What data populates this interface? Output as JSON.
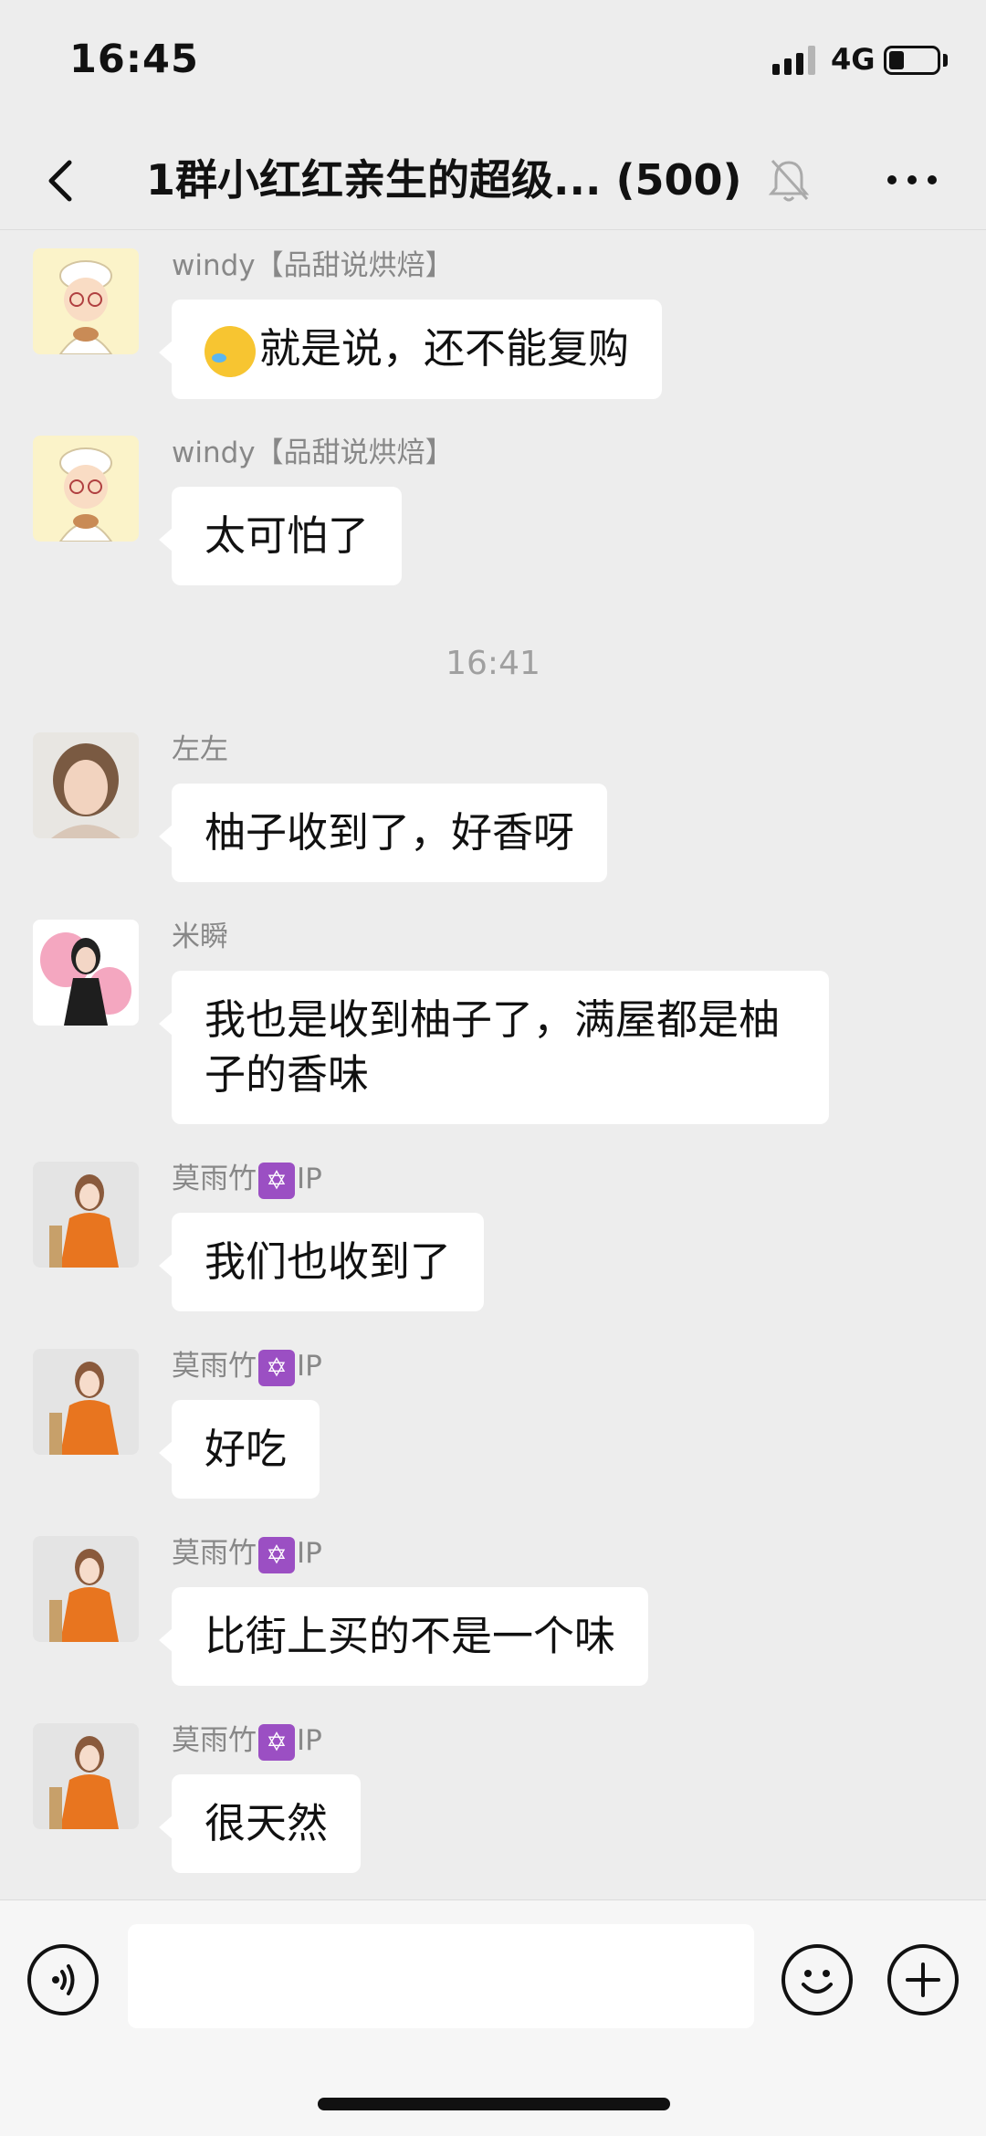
{
  "status_bar": {
    "time": "16:45",
    "network": "4G",
    "signal_bars": 3,
    "signal_bars_total": 4,
    "battery_level": 0.3
  },
  "nav": {
    "title": "1群小红红亲生的超级... (500)"
  },
  "icons": {
    "back": "chevron-left-icon",
    "mute": "bell-off-icon",
    "more": "more-dots-icon",
    "voice": "voice-icon",
    "emoji": "smiley-icon",
    "plus": "plus-icon"
  },
  "colors": {
    "background": "#ededed",
    "bubble": "#ffffff",
    "sender": "#888888",
    "timestamp": "#a0a0a0",
    "badge": "#9b4fc3"
  },
  "messages": [
    {
      "sender": "windy【品甜说烘焙】",
      "emoji": "crying-laughing-emoji",
      "text": "就是说，还不能复购"
    },
    {
      "sender": "windy【品甜说烘焙】",
      "text": "太可怕了"
    },
    {
      "timestamp": "16:41"
    },
    {
      "sender": "左左",
      "text": "柚子收到了，好香呀"
    },
    {
      "sender": "米瞬",
      "text": "我也是收到柚子了，满屋都是柚子的香味"
    },
    {
      "sender": "莫雨竹",
      "sender_badge": "✡",
      "sender_suffix": "IP",
      "text": "我们也收到了"
    },
    {
      "sender": "莫雨竹",
      "sender_badge": "✡",
      "sender_suffix": "IP",
      "text": "好吃"
    },
    {
      "sender": "莫雨竹",
      "sender_badge": "✡",
      "sender_suffix": "IP",
      "text": "比街上买的不是一个味"
    },
    {
      "sender": "莫雨竹",
      "sender_badge": "✡",
      "sender_suffix": "IP",
      "text": "很天然"
    }
  ],
  "input": {
    "value": "",
    "placeholder": ""
  }
}
